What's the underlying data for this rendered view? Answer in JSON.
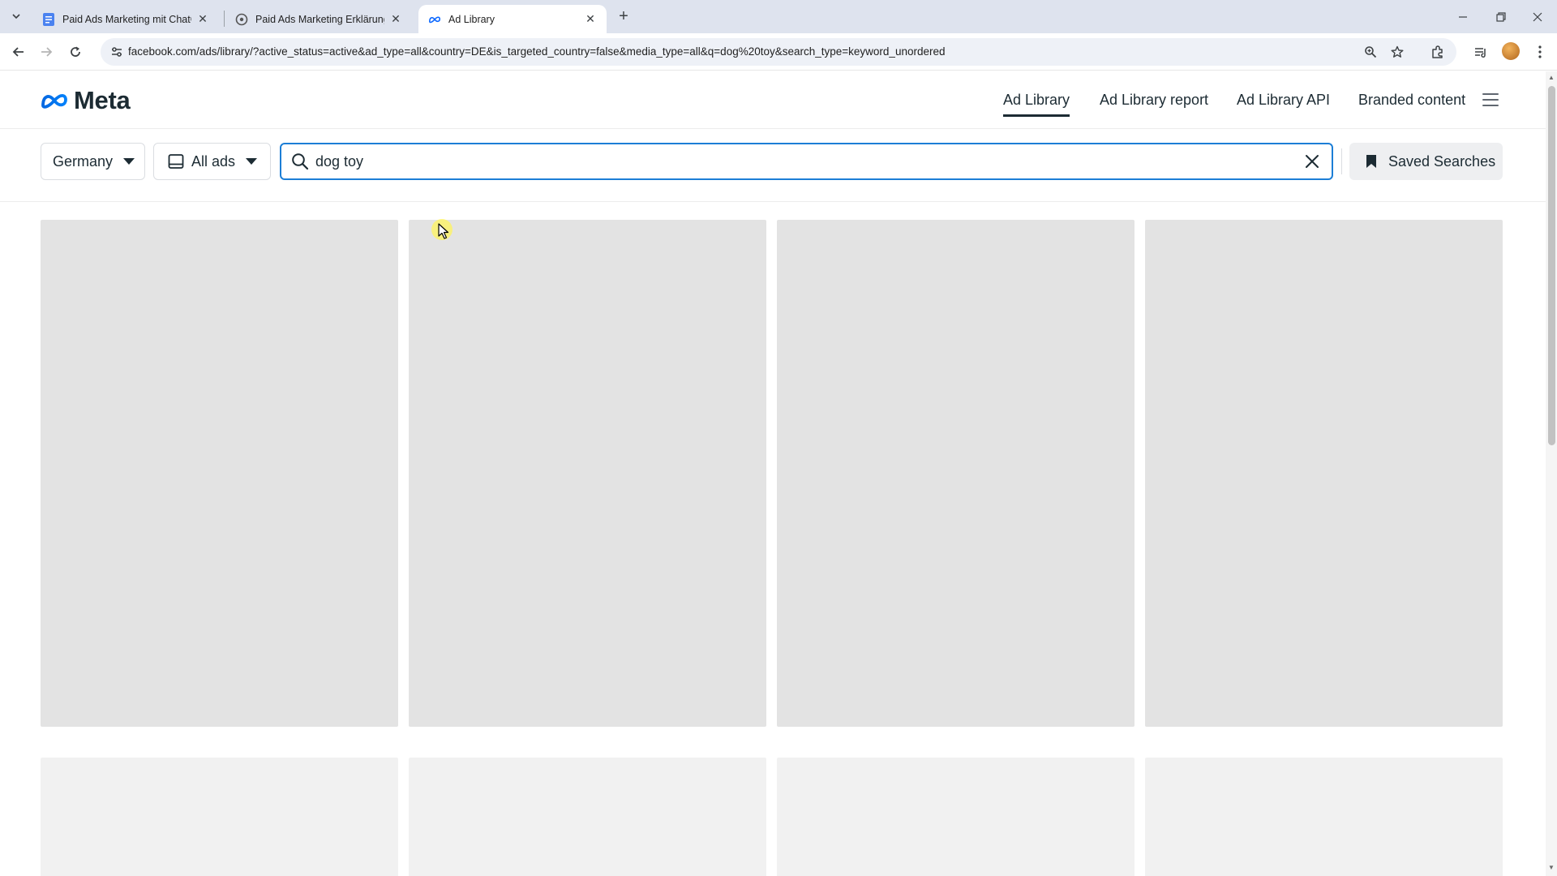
{
  "browser": {
    "tabs": [
      {
        "title": "Paid Ads Marketing mit ChatGPT",
        "active": false
      },
      {
        "title": "Paid Ads Marketing Erklärung",
        "active": false
      },
      {
        "title": "Ad Library",
        "active": true
      }
    ],
    "url": "facebook.com/ads/library/?active_status=active&ad_type=all&country=DE&is_targeted_country=false&media_type=all&q=dog%20toy&search_type=keyword_unordered"
  },
  "header": {
    "logo_text": "Meta",
    "nav": [
      "Ad Library",
      "Ad Library report",
      "Ad Library API",
      "Branded content"
    ],
    "active_nav": "Ad Library"
  },
  "filters": {
    "country": "Germany",
    "ad_type": "All ads",
    "search_value": "dog toy",
    "saved_searches_label": "Saved Searches"
  },
  "results": {
    "loading_placeholders": 8
  },
  "colors": {
    "accent": "#1c7ed6",
    "text": "#1c2b33",
    "placeholder": "#e3e3e3",
    "placeholder_faded": "#f1f1f1",
    "chrome_tabstrip": "#dee3ee"
  }
}
